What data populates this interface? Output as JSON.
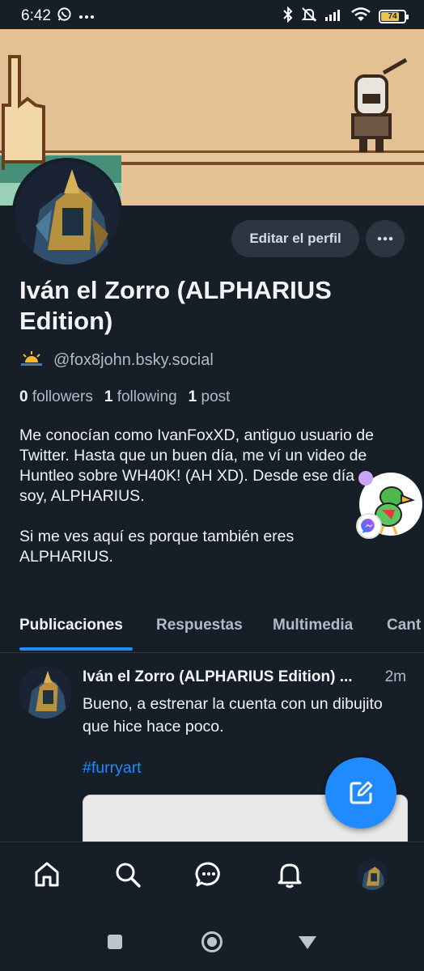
{
  "status_bar": {
    "time": "6:42",
    "battery": "74"
  },
  "profile": {
    "display_name": "Iván el Zorro (ALPHARIUS Edition)",
    "handle": "@fox8john.bsky.social",
    "edit_button": "Editar el perfil",
    "stats": {
      "followers_count": "0",
      "followers_label": "followers",
      "following_count": "1",
      "following_label": "following",
      "posts_count": "1",
      "posts_label": "post"
    },
    "bio": "Me conocían como IvanFoxXD, antiguo usuario de Twitter. Hasta que un buen día, me ví un video de Huntleo sobre WH40K! (AH XD). Desde ese día soy, ALPHARIUS.\n\nSi me ves aquí es porque también eres ALPHARIUS."
  },
  "tabs": [
    {
      "label": "Publicaciones"
    },
    {
      "label": "Respuestas"
    },
    {
      "label": "Multimedia"
    },
    {
      "label": "Cant"
    }
  ],
  "post": {
    "author": "Iván el Zorro (ALPHARIUS Edition) ...",
    "time": "2m",
    "text": "Bueno, a estrenar la cuenta con un dibujito que hice hace poco.",
    "hashtag": "#furryart"
  },
  "colors": {
    "background": "#161e27",
    "accent": "#208bfe",
    "button_bg": "#2b3642",
    "muted_text": "#aebbc9"
  },
  "icons": {
    "status_left": [
      "whatsapp-icon",
      "more-dots-icon"
    ],
    "status_right": [
      "bluetooth-icon",
      "muted-bell-icon",
      "signal-icon",
      "wifi-icon",
      "battery-icon"
    ],
    "bottom_nav": [
      "home-icon",
      "search-icon",
      "chat-icon",
      "notifications-icon",
      "profile-avatar"
    ],
    "system_nav": [
      "recents-icon",
      "home-circle-icon",
      "back-icon"
    ]
  }
}
